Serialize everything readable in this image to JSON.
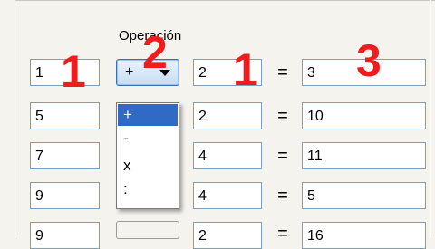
{
  "header": {
    "operation_label": "Operación"
  },
  "rows": [
    {
      "a": "1",
      "op": "+",
      "b": "2",
      "eq": "=",
      "result": "3"
    },
    {
      "a": "5",
      "op": "",
      "b": "2",
      "eq": "=",
      "result": "10"
    },
    {
      "a": "7",
      "op": "",
      "b": "4",
      "eq": "=",
      "result": "11"
    },
    {
      "a": "9",
      "op": "",
      "b": "4",
      "eq": "=",
      "result": "5"
    },
    {
      "a": "9",
      "op": "",
      "b": "2",
      "eq": "=",
      "result": "16"
    }
  ],
  "dropdown": {
    "options": [
      "+",
      "-",
      "x",
      ":"
    ],
    "selected_index": 0
  },
  "annotations": {
    "col1": "1",
    "col2": "2",
    "col3": "1",
    "col4": "3",
    "color": "#ee1c1c"
  }
}
